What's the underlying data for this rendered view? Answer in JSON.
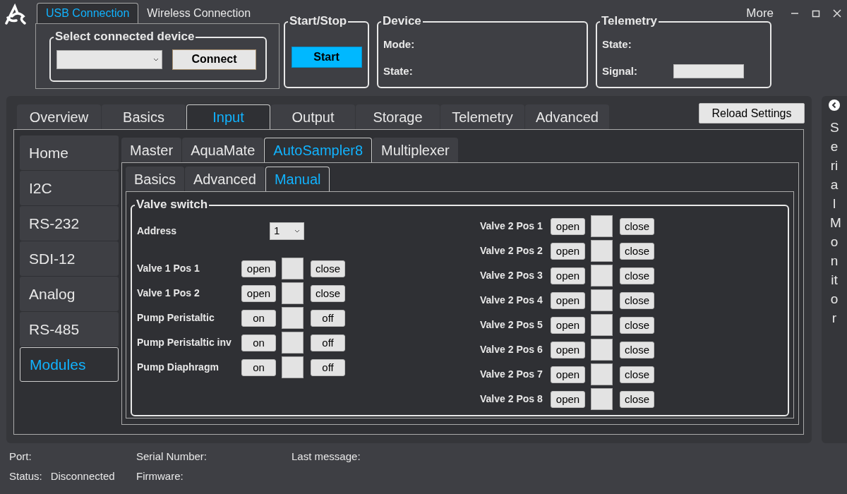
{
  "window": {
    "more": "More"
  },
  "connection_tabs": [
    {
      "label": "USB Connection",
      "selected": true
    },
    {
      "label": "Wireless Connection",
      "selected": false
    }
  ],
  "select_device": {
    "title": "Select connected device",
    "connect_button": "Connect"
  },
  "start_stop": {
    "title": "Start/Stop",
    "button": "Start"
  },
  "device": {
    "title": "Device",
    "fields": [
      "Mode:",
      "State:"
    ]
  },
  "telemetry": {
    "title": "Telemetry",
    "state_label": "State:",
    "signal_label": "Signal:"
  },
  "main_tabs": [
    {
      "label": "Overview",
      "selected": false
    },
    {
      "label": "Basics",
      "selected": false
    },
    {
      "label": "Input",
      "selected": true
    },
    {
      "label": "Output",
      "selected": false
    },
    {
      "label": "Storage",
      "selected": false
    },
    {
      "label": "Telemetry",
      "selected": false
    },
    {
      "label": "Advanced",
      "selected": false
    }
  ],
  "reload_button": "Reload Settings",
  "side_nav": [
    {
      "label": "Home",
      "selected": false
    },
    {
      "label": "I2C",
      "selected": false
    },
    {
      "label": "RS-232",
      "selected": false
    },
    {
      "label": "SDI-12",
      "selected": false
    },
    {
      "label": "Analog",
      "selected": false
    },
    {
      "label": "RS-485",
      "selected": false
    },
    {
      "label": "Modules",
      "selected": true
    }
  ],
  "module_tabs": [
    {
      "label": "Master",
      "selected": false
    },
    {
      "label": "AquaMate",
      "selected": false
    },
    {
      "label": "AutoSampler8",
      "selected": true
    },
    {
      "label": "Multiplexer",
      "selected": false
    }
  ],
  "sub_tabs": [
    {
      "label": "Basics",
      "selected": false
    },
    {
      "label": "Advanced",
      "selected": false
    },
    {
      "label": "Manual",
      "selected": true
    }
  ],
  "valve_switch": {
    "title": "Valve switch",
    "address_label": "Address",
    "address_value": "1",
    "left_rows": [
      {
        "label": "Valve 1 Pos 1",
        "on": "open",
        "off": "close"
      },
      {
        "label": "Valve 1 Pos 2",
        "on": "open",
        "off": "close"
      },
      {
        "label": "Pump Peristaltic",
        "on": "on",
        "off": "off"
      },
      {
        "label": "Pump Peristaltic inv",
        "on": "on",
        "off": "off"
      },
      {
        "label": "Pump Diaphragm",
        "on": "on",
        "off": "off"
      }
    ],
    "right_rows": [
      {
        "label": "Valve 2 Pos 1",
        "on": "open",
        "off": "close"
      },
      {
        "label": "Valve 2 Pos 2",
        "on": "open",
        "off": "close"
      },
      {
        "label": "Valve 2 Pos 3",
        "on": "open",
        "off": "close"
      },
      {
        "label": "Valve 2 Pos 4",
        "on": "open",
        "off": "close"
      },
      {
        "label": "Valve 2 Pos 5",
        "on": "open",
        "off": "close"
      },
      {
        "label": "Valve 2 Pos 6",
        "on": "open",
        "off": "close"
      },
      {
        "label": "Valve 2 Pos 7",
        "on": "open",
        "off": "close"
      },
      {
        "label": "Valve 2 Pos 8",
        "on": "open",
        "off": "close"
      }
    ]
  },
  "serial_monitor": "Serial Monitor",
  "status_bar": {
    "port_label": "Port:",
    "status_label": "Status:",
    "status_value": "Disconnected",
    "serial_label": "Serial Number:",
    "firmware_label": "Firmware:",
    "last_message_label": "Last message:"
  }
}
